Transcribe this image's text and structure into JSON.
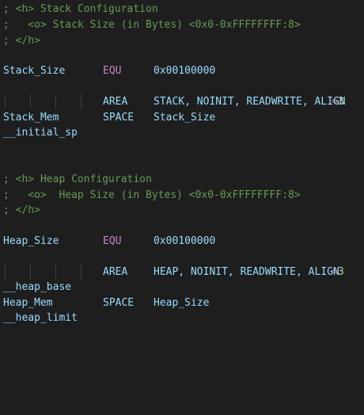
{
  "stack": {
    "comment_header": "; <h> Stack Configuration",
    "comment_option": ";   <o> Stack Size (in Bytes) <0x0-0xFFFFFFFF:8>",
    "comment_close": "; </h>",
    "size_label": "Stack_Size",
    "size_directive": "EQU",
    "size_value": "0x00100000",
    "area_directive": "AREA",
    "area_args": "STACK, NOINIT, READWRITE, ALIGN",
    "area_eq": "=",
    "area_align": "3",
    "mem_label": "Stack_Mem",
    "mem_directive": "SPACE",
    "mem_value": "Stack_Size",
    "top_label": "__initial_sp"
  },
  "heap": {
    "comment_header": "; <h> Heap Configuration",
    "comment_option": ";   <o>  Heap Size (in Bytes) <0x0-0xFFFFFFFF:8>",
    "comment_close": "; </h>",
    "size_label": "Heap_Size",
    "size_directive": "EQU",
    "size_value": "0x00100000",
    "area_directive": "AREA",
    "area_args": "HEAP, NOINIT, READWRITE, ALIGN",
    "area_eq": "=",
    "area_align": "3",
    "base_label": "__heap_base",
    "mem_label": "Heap_Mem",
    "mem_directive": "SPACE",
    "mem_value": "Heap_Size",
    "limit_label": "__heap_limit"
  },
  "colors": {
    "background": "#1e1e1e",
    "comment": "#6a9955",
    "identifier": "#9cdcfe",
    "directive": "#c586c0",
    "number": "#b5cea8"
  }
}
